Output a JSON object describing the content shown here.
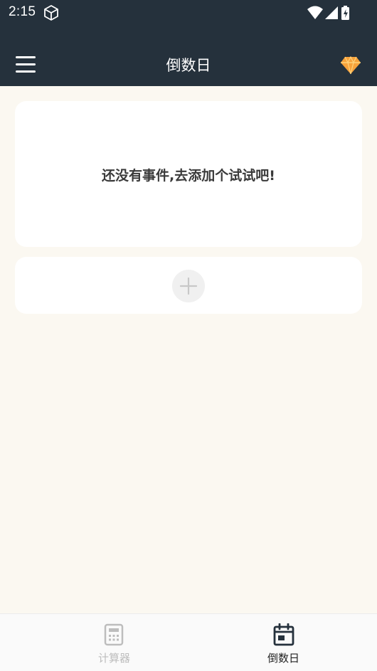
{
  "status_bar": {
    "time": "2:15",
    "left_icon": "cube-icon",
    "right_icons": [
      "wifi-icon",
      "signal-icon",
      "battery-icon"
    ]
  },
  "app_bar": {
    "title": "倒数日",
    "menu_icon": "hamburger-menu-icon",
    "premium_icon": "diamond-icon"
  },
  "empty_state": {
    "message": "还没有事件,去添加个试试吧!"
  },
  "add_event": {
    "icon": "plus-icon"
  },
  "bottom_nav": {
    "items": [
      {
        "label": "计算器",
        "icon": "calculator-icon",
        "active": false
      },
      {
        "label": "倒数日",
        "icon": "calendar-icon",
        "active": true
      }
    ]
  },
  "colors": {
    "header": "#25313C",
    "background": "#FBF8F1",
    "card": "#FFFFFF",
    "accent_gem": "#F7A23B"
  }
}
